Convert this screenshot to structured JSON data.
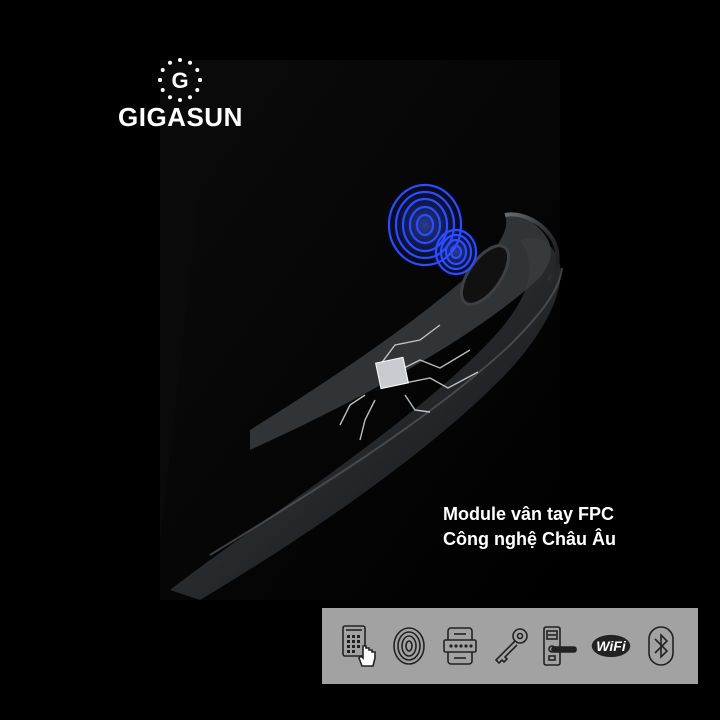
{
  "brand": {
    "name": "GIGASUN",
    "logo_letter": "G"
  },
  "caption": {
    "line1": "Module vân tay FPC",
    "line2": "Công nghệ Châu Âu"
  },
  "features": {
    "wifi_label": "WiFi",
    "icons": [
      "keypad-touch-icon",
      "fingerprint-icon",
      "card-reader-icon",
      "key-icon",
      "door-handle-icon",
      "wifi-icon",
      "bluetooth-icon"
    ]
  },
  "colors": {
    "background": "#000000",
    "fingerprint_glow": "#2a4dff",
    "feature_bar": "#a2a2a2",
    "icon_stroke": "#222222",
    "text": "#ffffff"
  }
}
